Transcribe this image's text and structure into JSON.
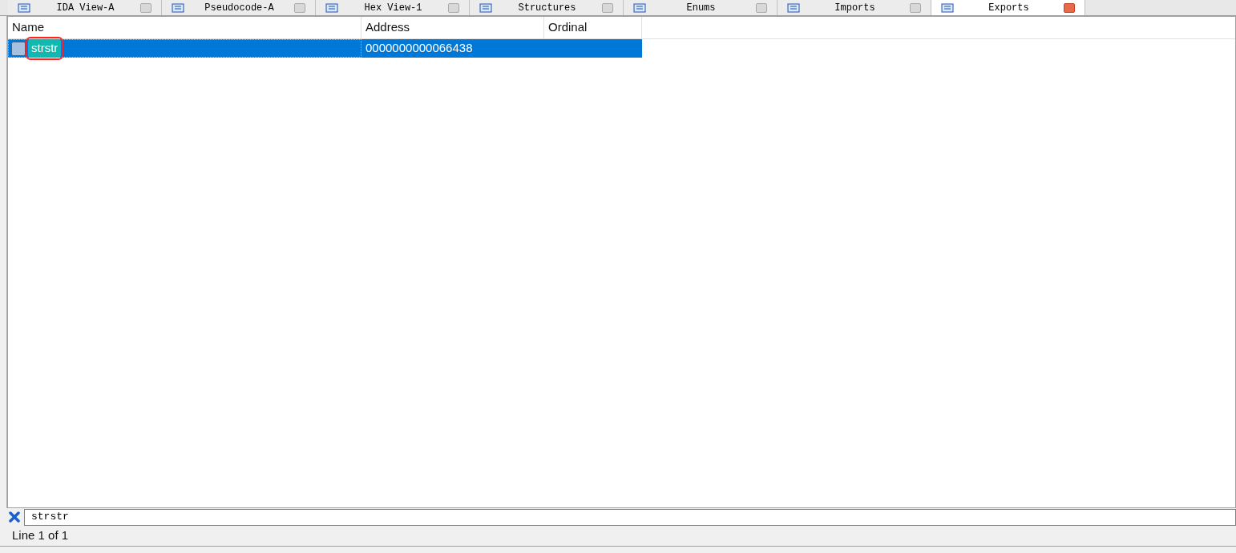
{
  "tabs": [
    {
      "label": "IDA View-A",
      "selected": false
    },
    {
      "label": "Pseudocode-A",
      "selected": false
    },
    {
      "label": "Hex View-1",
      "selected": false
    },
    {
      "label": "Structures",
      "selected": false
    },
    {
      "label": "Enums",
      "selected": false
    },
    {
      "label": "Imports",
      "selected": false
    },
    {
      "label": "Exports",
      "selected": true
    }
  ],
  "table": {
    "columns": [
      "Name",
      "Address",
      "Ordinal"
    ],
    "rows": [
      {
        "name": "strstr",
        "address": "0000000000066438",
        "selected": true,
        "highlighted": true
      }
    ]
  },
  "filter": {
    "value": "strstr"
  },
  "status_bar": {
    "text": "Line 1 of 1"
  }
}
